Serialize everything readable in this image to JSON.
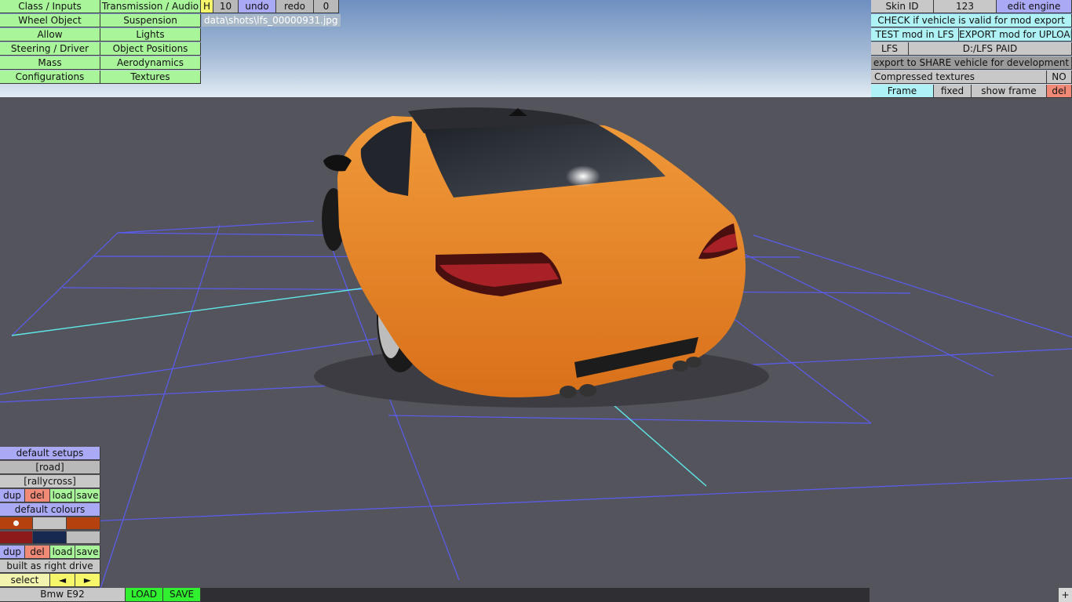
{
  "tabs_left": [
    {
      "label": "Class / Inputs"
    },
    {
      "label": "Transmission / Audio"
    },
    {
      "label": "Wheel Object"
    },
    {
      "label": "Suspension"
    },
    {
      "label": "Allow"
    },
    {
      "label": "Lights"
    },
    {
      "label": "Steering / Driver"
    },
    {
      "label": "Object Positions"
    },
    {
      "label": "Mass"
    },
    {
      "label": "Aerodynamics"
    },
    {
      "label": "Configurations"
    },
    {
      "label": "Textures"
    }
  ],
  "toolbar": {
    "h": "H",
    "num": "10",
    "undo": "undo",
    "redo": "redo",
    "count": "0"
  },
  "screenshot_path": "data\\shots\\lfs_00000931.jpg",
  "right_panel": {
    "skin_id_label": "Skin ID",
    "skin_id_value": "123",
    "edit_engine": "edit engine",
    "check_valid": "CHECK if vehicle is valid for mod export",
    "test_mod": "TEST mod in LFS",
    "export_mod": "EXPORT mod for UPLOAD",
    "lfs_label": "LFS",
    "lfs_path": "D:/LFS PAID",
    "export_share": "export to SHARE vehicle for development",
    "compressed_label": "Compressed textures",
    "compressed_value": "NO",
    "frame": "Frame",
    "fixed": "fixed",
    "show_frame": "show frame",
    "del": "del"
  },
  "setups": {
    "default_setups": "default setups",
    "road": "[road]",
    "rallycross": "[rallycross]",
    "dup": "dup",
    "del": "del",
    "load": "load",
    "save": "save"
  },
  "colours": {
    "default_colours": "default colours",
    "swatches": [
      "#b5420e",
      "#c4c4c4",
      "#b5420e",
      "#8c1a1a",
      "#18294f",
      "#bdbdbd"
    ],
    "dup": "dup",
    "del": "del",
    "load": "load",
    "save": "save"
  },
  "drive": "built as right drive",
  "select": {
    "label": "select",
    "prev": "◄",
    "next": "►"
  },
  "bottom": {
    "car_name": "Bmw E92",
    "load": "LOAD",
    "save": "SAVE",
    "plus": "+"
  },
  "colors": {
    "car_body": "#e8841e",
    "grid_line": "#5a5cf2",
    "grid_axis": "#5fe8e8",
    "floor": "#54545c"
  }
}
